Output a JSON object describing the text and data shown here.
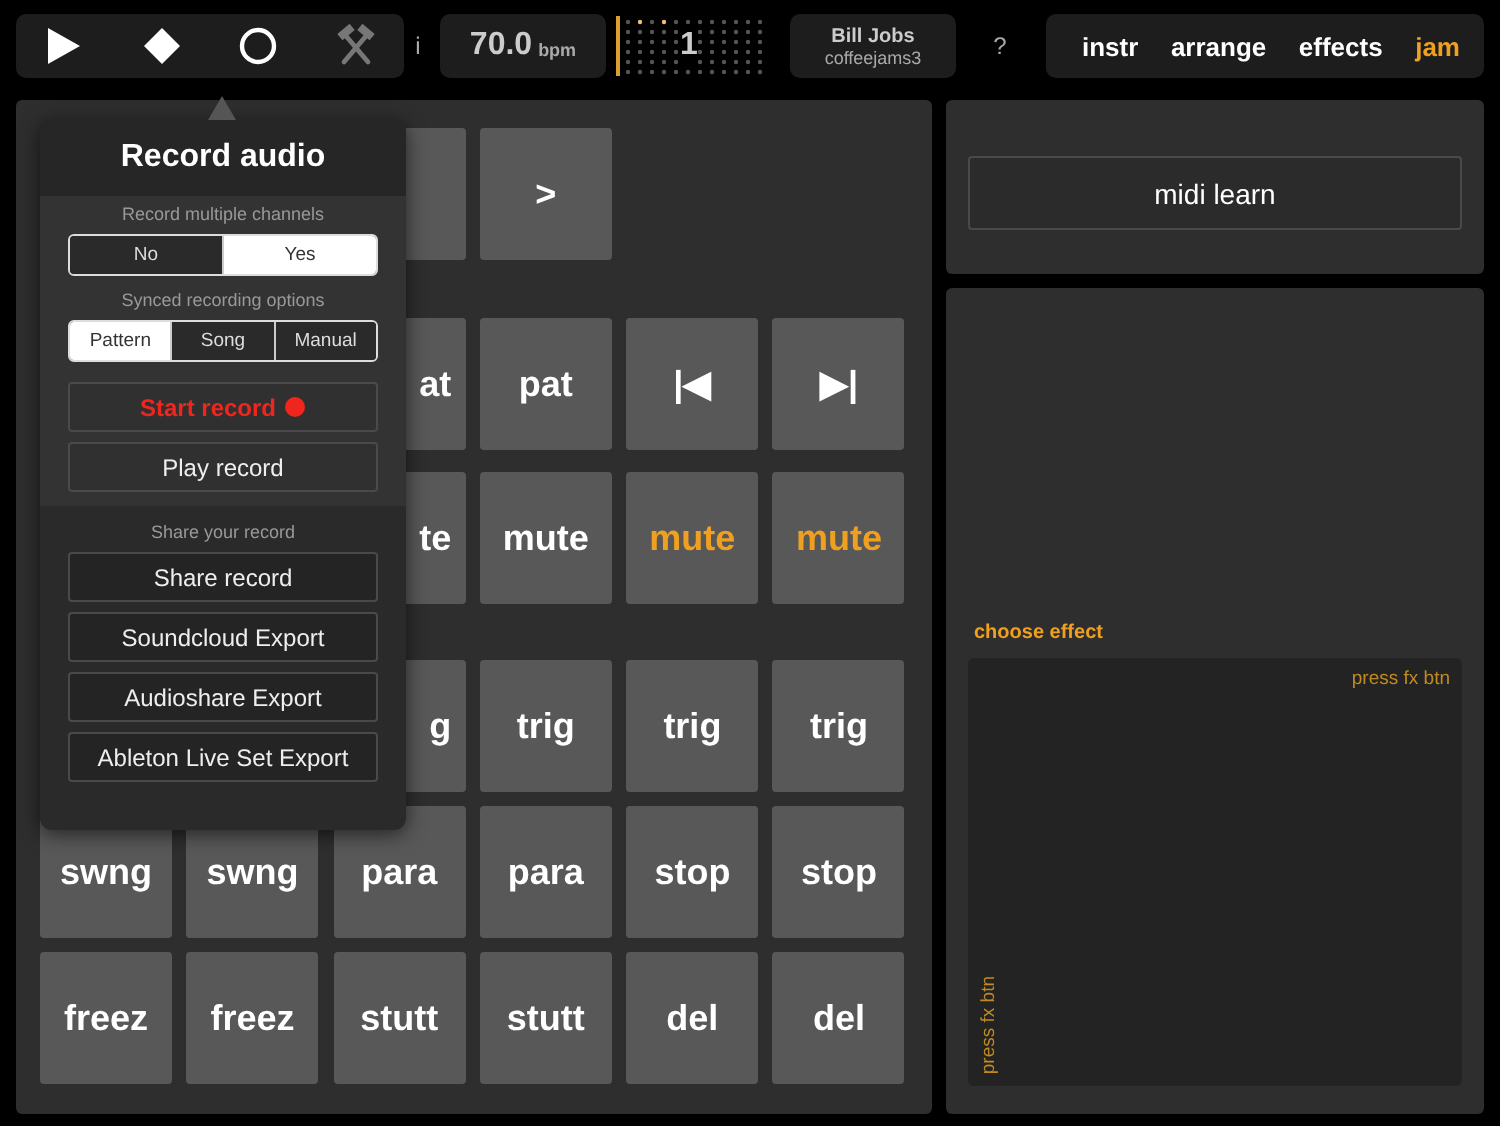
{
  "transport": [
    {
      "kind": "play",
      "disabled": false
    },
    {
      "kind": "stop",
      "disabled": false
    },
    {
      "kind": "record",
      "disabled": false
    },
    {
      "kind": "tools",
      "disabled": true
    }
  ],
  "info": "i",
  "bpm": {
    "value": "70.0",
    "unit": "bpm"
  },
  "beat": "1",
  "user": {
    "name": "Bill Jobs",
    "project": "coffeejams3"
  },
  "help": "?",
  "tabs": [
    {
      "label": "instr",
      "selected": false
    },
    {
      "label": "arrange",
      "selected": false
    },
    {
      "label": "effects",
      "selected": false
    },
    {
      "label": "jam",
      "selected": true
    }
  ],
  "pad_sections": [
    {
      "rows": [
        [
          {
            "kind": "blank"
          },
          {
            "kind": "blank"
          },
          {
            "kind": "pad"
          },
          {
            "kind": "pad",
            "label": ">",
            "active": false
          },
          {
            "kind": "blank"
          },
          {
            "kind": "blank"
          }
        ]
      ]
    },
    {
      "rows": [
        [
          {
            "kind": "blank"
          },
          {
            "kind": "blank"
          },
          {
            "kind": "partial",
            "label": "at",
            "active": false
          },
          {
            "kind": "pad",
            "label": "pat",
            "active": false
          },
          {
            "kind": "pad",
            "label": "|◀",
            "active": false
          },
          {
            "kind": "pad",
            "label": "▶|",
            "active": false
          }
        ],
        [
          {
            "kind": "blank"
          },
          {
            "kind": "blank"
          },
          {
            "kind": "partial",
            "label": "te",
            "active": false
          },
          {
            "kind": "pad",
            "label": "mute",
            "active": false
          },
          {
            "kind": "pad",
            "label": "mute",
            "active": true
          },
          {
            "kind": "pad",
            "label": "mute",
            "active": true
          }
        ]
      ]
    },
    {
      "rows": [
        [
          {
            "kind": "blank"
          },
          {
            "kind": "blank"
          },
          {
            "kind": "partial",
            "label": "g",
            "active": false
          },
          {
            "kind": "pad",
            "label": "trig",
            "active": false
          },
          {
            "kind": "pad",
            "label": "trig",
            "active": false
          },
          {
            "kind": "pad",
            "label": "trig",
            "active": false
          }
        ],
        [
          {
            "kind": "pad",
            "label": "swng",
            "active": false
          },
          {
            "kind": "pad",
            "label": "swng",
            "active": false
          },
          {
            "kind": "pad",
            "label": "para",
            "active": false
          },
          {
            "kind": "pad",
            "label": "para",
            "active": false
          },
          {
            "kind": "pad",
            "label": "stop",
            "active": false
          },
          {
            "kind": "pad",
            "label": "stop",
            "active": false
          }
        ],
        [
          {
            "kind": "pad",
            "label": "freez",
            "active": false
          },
          {
            "kind": "pad",
            "label": "freez",
            "active": false
          },
          {
            "kind": "pad",
            "label": "stutt",
            "active": false
          },
          {
            "kind": "pad",
            "label": "stutt",
            "active": false
          },
          {
            "kind": "pad",
            "label": "del",
            "active": false
          },
          {
            "kind": "pad",
            "label": "del",
            "active": false
          }
        ]
      ]
    }
  ],
  "popover": {
    "title": "Record audio",
    "multi_channel": {
      "label": "Record multiple channels",
      "options": [
        {
          "label": "No",
          "selected": false
        },
        {
          "label": "Yes",
          "selected": true
        }
      ]
    },
    "sync": {
      "label": "Synced recording options",
      "options": [
        {
          "label": "Pattern",
          "selected": true
        },
        {
          "label": "Song",
          "selected": false
        },
        {
          "label": "Manual",
          "selected": false
        }
      ]
    },
    "start_record": "Start record",
    "play_record": "Play record",
    "share_label": "Share your record",
    "share_buttons": [
      "Share record",
      "Soundcloud Export",
      "Audioshare Export",
      "Ableton Live Set Export"
    ]
  },
  "midi_learn": "midi learn",
  "effect": {
    "label": "choose effect",
    "x_hint": "press fx btn",
    "y_hint": "press fx btn"
  }
}
